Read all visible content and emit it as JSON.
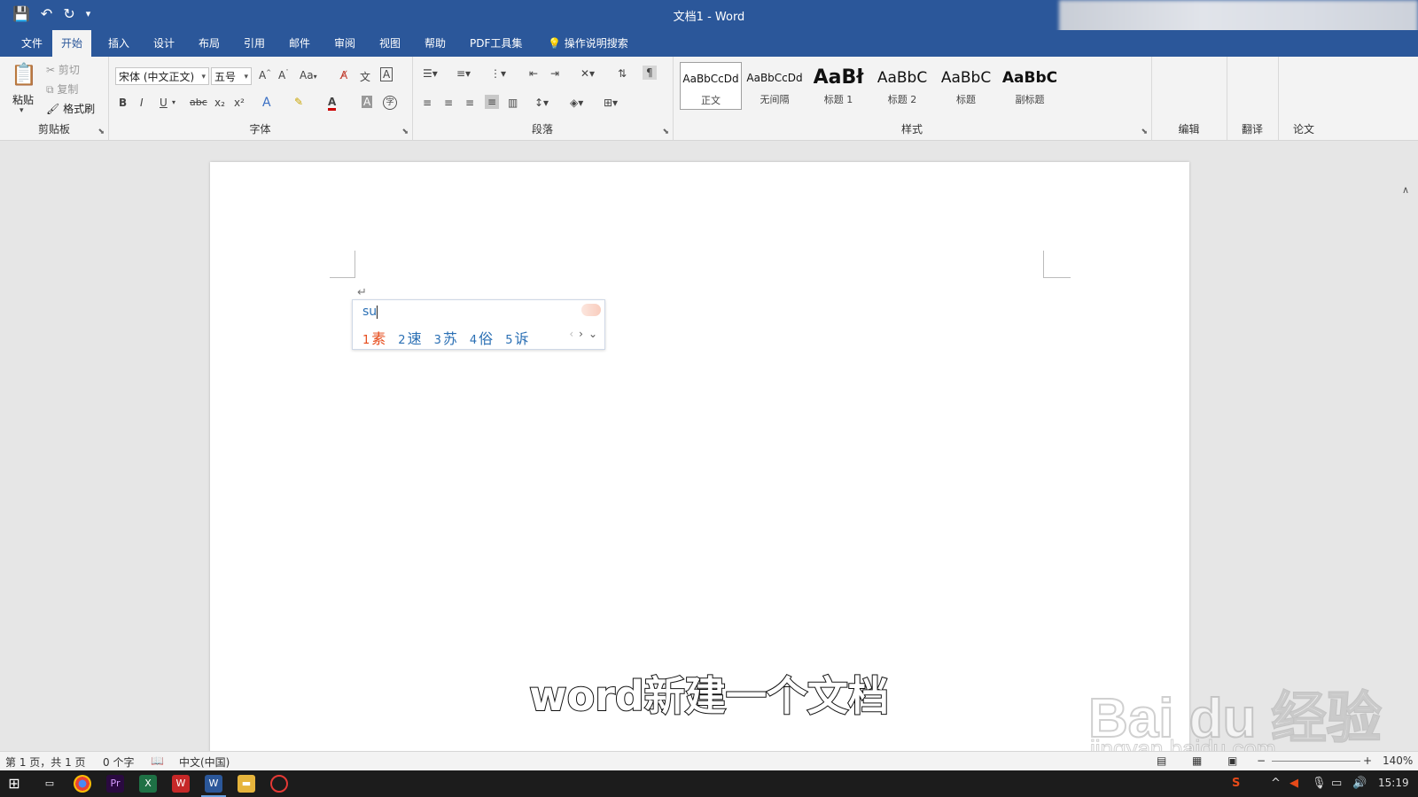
{
  "window": {
    "title": "文档1 - Word"
  },
  "qat": {
    "save": "save-icon",
    "undo": "undo-icon",
    "redo": "redo-icon",
    "customize": "customize-icon"
  },
  "menu": [
    "文件",
    "开始",
    "插入",
    "设计",
    "布局",
    "引用",
    "邮件",
    "审阅",
    "视图",
    "帮助",
    "PDF工具集"
  ],
  "menu_active": "开始",
  "tell_me": "操作说明搜索",
  "clipboard": {
    "paste": "粘贴",
    "cut": "剪切",
    "copy": "复制",
    "format_painter": "格式刷",
    "label": "剪贴板"
  },
  "font": {
    "name": "宋体 (中文正文)",
    "size": "五号",
    "label": "字体",
    "change_case": "Aa",
    "bold": "B",
    "italic": "I",
    "underline": "U",
    "strike": "abc",
    "sub": "x₂",
    "sup": "x²"
  },
  "paragraph": {
    "label": "段落"
  },
  "styles": {
    "label": "样式",
    "items": [
      {
        "preview": "AaBbCcDd",
        "name": "正文"
      },
      {
        "preview": "AaBbCcDd",
        "name": "无间隔"
      },
      {
        "preview": "AaBł",
        "name": "标题 1"
      },
      {
        "preview": "AaBbC",
        "name": "标题 2"
      },
      {
        "preview": "AaBbC",
        "name": "标题"
      },
      {
        "preview": "AaBbC",
        "name": "副标题"
      }
    ]
  },
  "right_groups": {
    "edit": "编辑",
    "translate": "翻译",
    "paper": "论文"
  },
  "ime": {
    "input": "su",
    "candidates": [
      {
        "n": "1",
        "c": "素"
      },
      {
        "n": "2",
        "c": "速"
      },
      {
        "n": "3",
        "c": "苏"
      },
      {
        "n": "4",
        "c": "俗"
      },
      {
        "n": "5",
        "c": "诉"
      }
    ]
  },
  "caption": "word新建一个文档",
  "watermark": {
    "brand": "Bai du 经验",
    "url": "jingyan.baidu.com"
  },
  "status": {
    "page": "第 1 页，共 1 页",
    "words": "0 个字",
    "lang": "中文(中国)",
    "zoom": "140%"
  },
  "taskbar": {
    "time": "15:19"
  }
}
